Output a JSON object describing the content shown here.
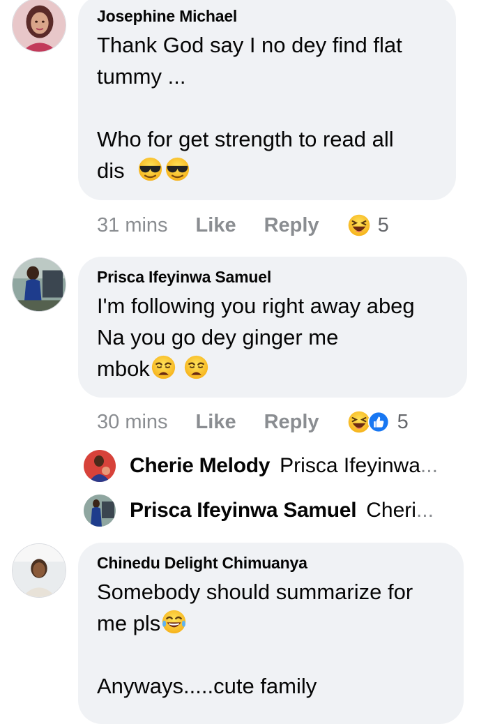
{
  "comments": [
    {
      "author": "Josephine Michael",
      "lines": [
        "Thank God say  I no dey find  flat",
        "tummy  ...",
        "",
        "Who for  get  strength  to read all",
        "dis"
      ],
      "emojis": [
        "sunglasses-face",
        "sunglasses-face"
      ],
      "time": "31 mins",
      "like_label": "Like",
      "reply_label": "Reply",
      "reactions": [
        "laughing"
      ],
      "reaction_count": "5"
    },
    {
      "author": "Prisca Ifeyinwa Samuel",
      "lines": [
        "I'm following you right away abeg",
        "Na you go dey ginger me",
        "mbok"
      ],
      "emojis": [
        "weary-face",
        "weary-face"
      ],
      "time": "30 mins",
      "like_label": "Like",
      "reply_label": "Reply",
      "reactions": [
        "laughing",
        "thumbs-up"
      ],
      "reaction_count": "5",
      "replies": [
        {
          "name": "Cherie Melody",
          "snippet": "Prisca Ifeyinwa",
          "ellipsis": "..."
        },
        {
          "name": "Prisca Ifeyinwa Samuel",
          "snippet": "Cheri",
          "ellipsis": "..."
        }
      ]
    },
    {
      "author": "Chinedu Delight Chimuanya",
      "lines": [
        "Somebody should summarize for",
        "me pls",
        "",
        "Anyways.....cute family"
      ],
      "emojis": [
        "tears-of-joy"
      ],
      "time": "",
      "reactions": []
    }
  ],
  "colors": {
    "bubble": "#f0f2f5",
    "meta_text": "#8a8d91",
    "like_blue": "#1877f2",
    "emoji_yellow": "#fcc21b"
  }
}
